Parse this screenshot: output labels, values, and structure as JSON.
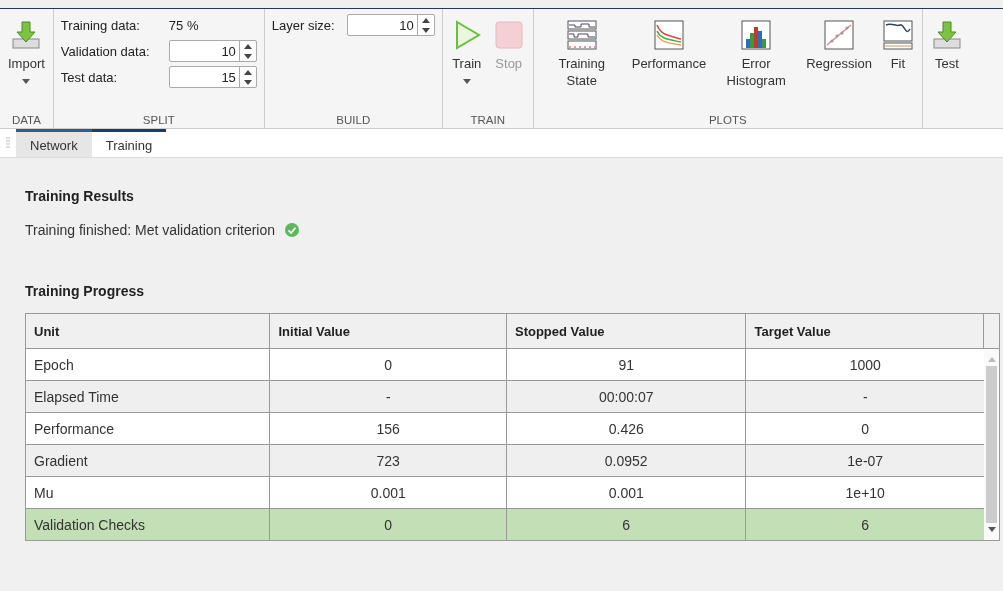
{
  "ribbon": {
    "groups": [
      {
        "label": "DATA",
        "kind": "buttons",
        "buttons": [
          {
            "label": "Import",
            "kind": "import",
            "dropdown": true,
            "disabled": false
          }
        ]
      },
      {
        "label": "SPLIT",
        "kind": "fields",
        "fields": [
          {
            "label": "Training data:",
            "kind": "text",
            "value": "75 %"
          },
          {
            "label": "Validation data:",
            "kind": "spinner",
            "value": "10"
          },
          {
            "label": "Test data:",
            "kind": "spinner",
            "value": "15"
          }
        ]
      },
      {
        "label": "BUILD",
        "kind": "fields",
        "fields": [
          {
            "label": "Layer size:",
            "kind": "spinner",
            "value": "10"
          }
        ]
      },
      {
        "label": "TRAIN",
        "kind": "buttons",
        "buttons": [
          {
            "label": "Train",
            "kind": "train",
            "dropdown": true,
            "disabled": false
          },
          {
            "label": "Stop",
            "kind": "stop",
            "dropdown": false,
            "disabled": true
          }
        ]
      },
      {
        "label": "PLOTS",
        "kind": "buttons",
        "buttons": [
          {
            "label": "Training State",
            "kind": "state",
            "dropdown": false,
            "disabled": false
          },
          {
            "label": "Performance",
            "kind": "performance",
            "dropdown": false,
            "disabled": false
          },
          {
            "label": "Error Histogram",
            "kind": "histogram",
            "dropdown": false,
            "disabled": false
          },
          {
            "label": "Regression",
            "kind": "regression",
            "dropdown": false,
            "disabled": false
          },
          {
            "label": "Fit",
            "kind": "fit",
            "dropdown": false,
            "disabled": false
          }
        ]
      },
      {
        "kind": "buttons",
        "buttons": [
          {
            "label": "Test",
            "kind": "import",
            "dropdown": false,
            "disabled": false
          }
        ]
      }
    ]
  },
  "tabs": [
    {
      "label": "Network",
      "selected": false
    },
    {
      "label": "Training",
      "selected": true
    }
  ],
  "results": {
    "title": "Training Results",
    "status": "Training finished: Met validation criterion",
    "success": true
  },
  "progress": {
    "title": "Training Progress",
    "columns": [
      "Unit",
      "Initial Value",
      "Stopped Value",
      "Target Value"
    ],
    "rows": [
      {
        "cells": [
          "Epoch",
          "0",
          "91",
          "1000"
        ],
        "selected": false
      },
      {
        "cells": [
          "Elapsed Time",
          "-",
          "00:00:07",
          "-"
        ],
        "selected": false
      },
      {
        "cells": [
          "Performance",
          "156",
          "0.426",
          "0"
        ],
        "selected": false
      },
      {
        "cells": [
          "Gradient",
          "723",
          "0.0952",
          "1e-07"
        ],
        "selected": false
      },
      {
        "cells": [
          "Mu",
          "0.001",
          "0.001",
          "1e+10"
        ],
        "selected": false
      },
      {
        "cells": [
          "Validation Checks",
          "0",
          "6",
          "6"
        ],
        "selected": true
      }
    ]
  }
}
